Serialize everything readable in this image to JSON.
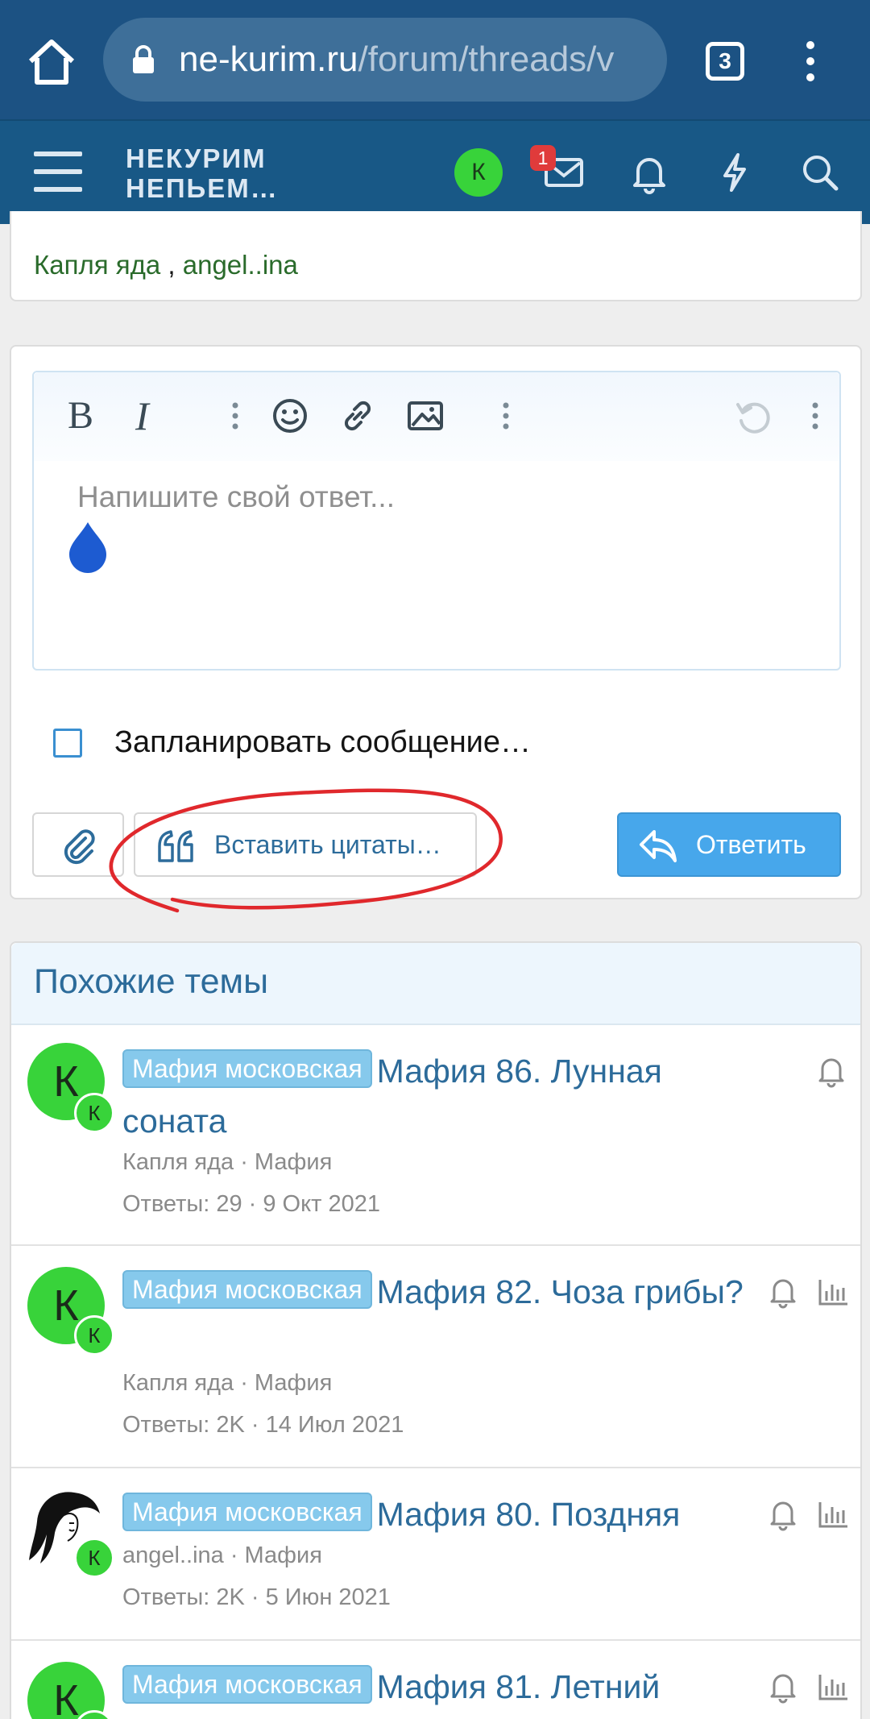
{
  "browser": {
    "url_domain": "ne-kurim.ru",
    "url_path": "/forum/threads/v",
    "tab_count": "3"
  },
  "header": {
    "logo_line1": "НЕКУРИМ",
    "logo_line2": "НЕПЬЕМ…",
    "avatar_letter": "К",
    "inbox_badge": "1"
  },
  "likes": {
    "user1": "Капля яда",
    "separator": " , ",
    "user2": "angel..ina"
  },
  "editor": {
    "placeholder": "Напишите свой ответ...",
    "schedule_label": "Запланировать сообщение…",
    "insert_quotes_label": "Вставить цитаты…",
    "reply_label": "Ответить"
  },
  "similar": {
    "title": "Похожие темы",
    "threads": [
      {
        "avatar_letter": "К",
        "mini_letter": "К",
        "prefix": "Мафия московская",
        "title": "Мафия 86. Лунная соната",
        "author_forum": "Капля яда · Мафия",
        "stats": "Ответы: 29 · 9 Окт 2021"
      },
      {
        "avatar_letter": "К",
        "mini_letter": "К",
        "prefix": "Мафия московская",
        "title": "Мафия 82. Чоза грибы?",
        "author_forum": "Капля яда · Мафия",
        "stats": "Ответы: 2K · 14 Июл 2021"
      },
      {
        "avatar_letter": "",
        "mini_letter": "К",
        "prefix": "Мафия московская",
        "title": "Мафия 80. Поздняя",
        "author_forum": "angel..ina · Мафия",
        "stats": "Ответы: 2K · 5 Июн 2021"
      },
      {
        "avatar_letter": "К",
        "mini_letter": "К",
        "prefix": "Мафия московская",
        "title": "Мафия 81. Летний",
        "author_forum": "",
        "stats": ""
      }
    ]
  },
  "icons": {
    "home": "home-icon",
    "lock": "lock-icon",
    "menu": "more-vertical-icon",
    "inbox": "envelope-icon",
    "alerts": "bell-icon",
    "whats_new": "bolt-icon",
    "search": "search-icon",
    "emoji": "smile-icon",
    "link": "link-icon",
    "image": "image-icon",
    "undo": "undo-icon",
    "attach": "paperclip-icon",
    "quote": "quote-icon",
    "reply": "reply-arrow-icon",
    "watch": "bell-icon",
    "poll": "bar-chart-icon"
  },
  "colors": {
    "browser_bar": "#1c5283",
    "forum_bar": "#185886",
    "accent": "#47a7eb",
    "prefix": "#86c9ec",
    "link": "#2c6b9a",
    "avatar_green": "#38d33a",
    "annotation": "#e0282c"
  }
}
